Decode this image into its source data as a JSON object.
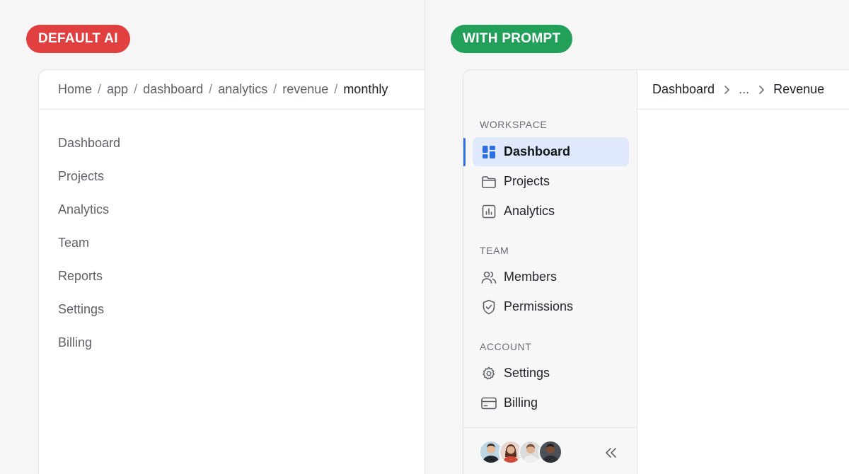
{
  "left": {
    "badge": "DEFAULT AI",
    "breadcrumb": [
      "Home",
      "app",
      "dashboard",
      "analytics",
      "revenue",
      "monthly"
    ],
    "nav": [
      "Dashboard",
      "Projects",
      "Analytics",
      "Team",
      "Reports",
      "Settings",
      "Billing"
    ]
  },
  "right": {
    "badge": "WITH PROMPT",
    "breadcrumb": {
      "first": "Dashboard",
      "middle": "...",
      "last": "Revenue"
    },
    "sections": {
      "workspace": "WORKSPACE",
      "team": "TEAM",
      "account": "ACCOUNT"
    },
    "nav": {
      "dashboard": "Dashboard",
      "projects": "Projects",
      "analytics": "Analytics",
      "members": "Members",
      "permissions": "Permissions",
      "settings": "Settings",
      "billing": "Billing"
    },
    "icons": {
      "dashboard": "grid-icon",
      "projects": "folder-icon",
      "analytics": "chart-icon",
      "members": "users-icon",
      "permissions": "shield-icon",
      "settings": "gear-icon",
      "billing": "credit-card-icon",
      "collapse": "double-chevron-left-icon"
    }
  },
  "colors": {
    "default_badge": "#e0403f",
    "prompt_badge": "#22a05a",
    "accent": "#2f6fe0",
    "active_bg": "#dfe9fb"
  }
}
